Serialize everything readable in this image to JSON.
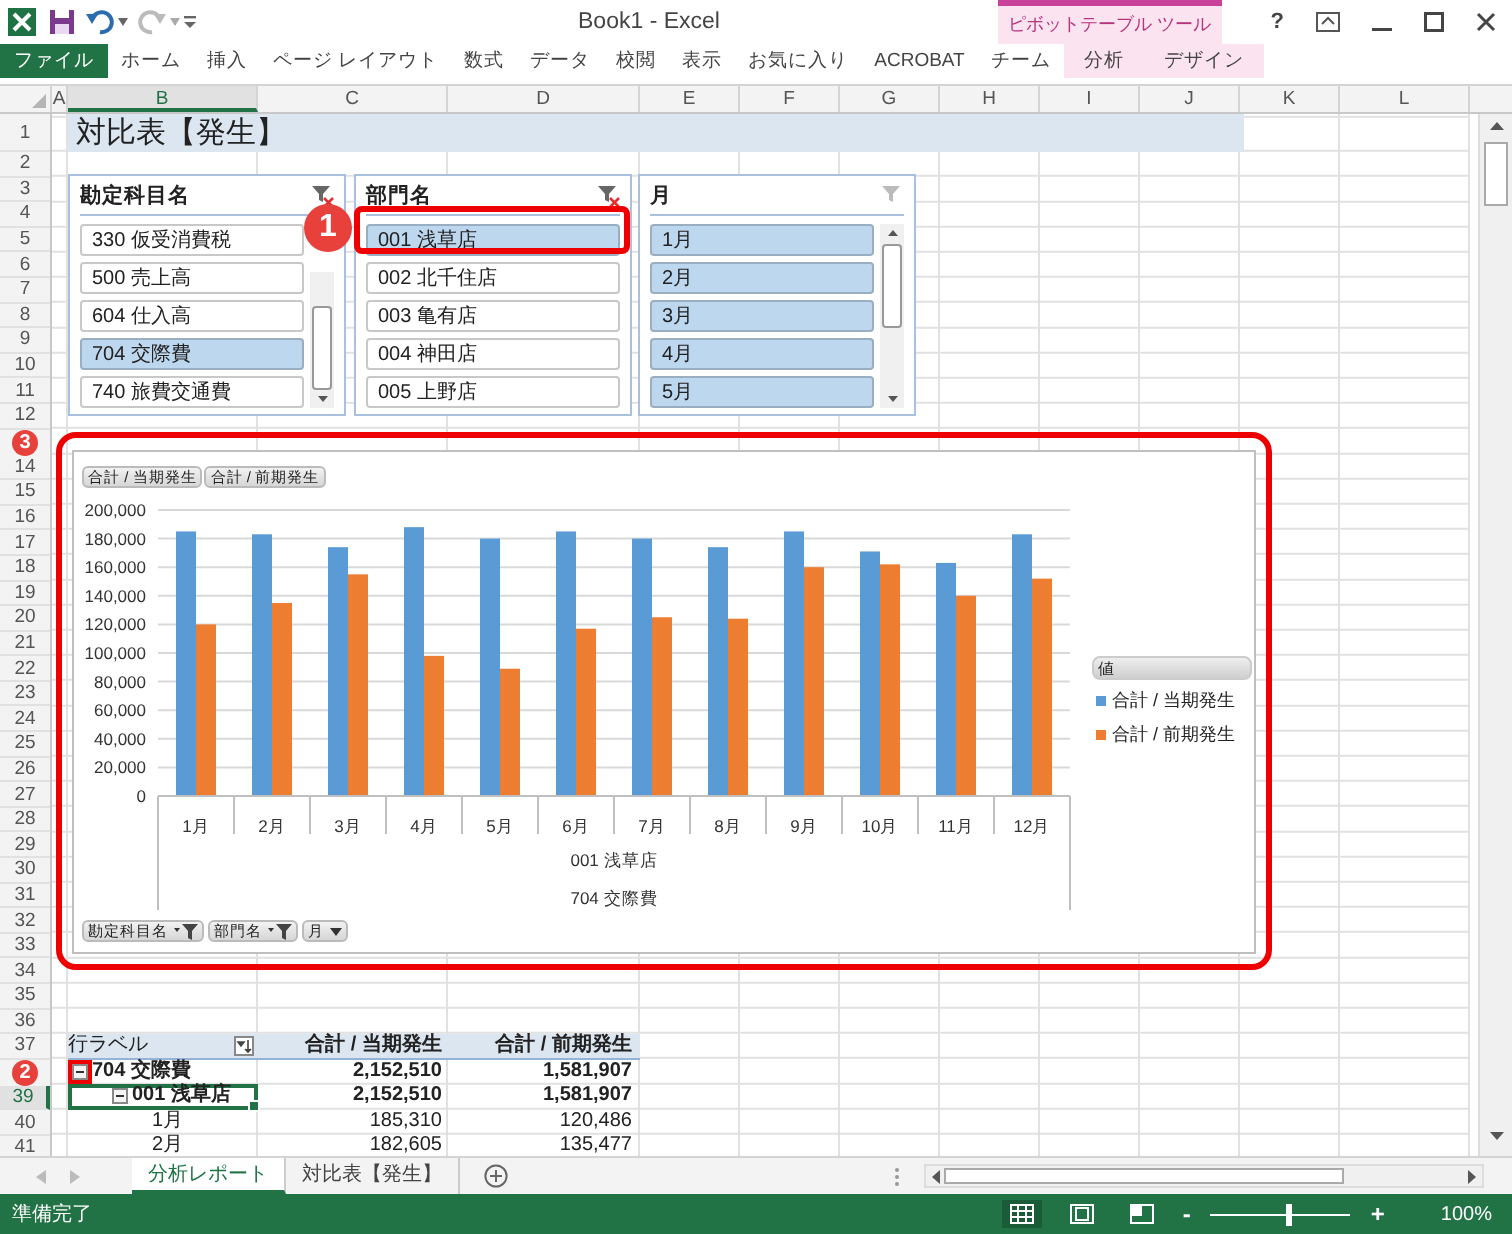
{
  "title_bar": {
    "title": "Book1 - Excel",
    "context_group": "ピボットテーブル ツール",
    "help": "?"
  },
  "ribbon_tabs": [
    {
      "label": "ファイル",
      "kind": "file"
    },
    {
      "label": "ホーム",
      "kind": "normal"
    },
    {
      "label": "挿入",
      "kind": "normal"
    },
    {
      "label": "ページ レイアウト",
      "kind": "normal"
    },
    {
      "label": "数式",
      "kind": "normal"
    },
    {
      "label": "データ",
      "kind": "normal"
    },
    {
      "label": "校閲",
      "kind": "normal"
    },
    {
      "label": "表示",
      "kind": "normal"
    },
    {
      "label": "お気に入り",
      "kind": "normal"
    },
    {
      "label": "ACROBAT",
      "kind": "normal"
    },
    {
      "label": "チーム",
      "kind": "normal"
    },
    {
      "label": "分析",
      "kind": "contextual"
    },
    {
      "label": "デザイン",
      "kind": "contextual"
    }
  ],
  "columns": [
    {
      "label": "A",
      "selected": false
    },
    {
      "label": "B",
      "selected": true
    },
    {
      "label": "C",
      "selected": false
    },
    {
      "label": "D",
      "selected": false
    },
    {
      "label": "E",
      "selected": false
    },
    {
      "label": "F",
      "selected": false
    },
    {
      "label": "G",
      "selected": false
    },
    {
      "label": "H",
      "selected": false
    },
    {
      "label": "I",
      "selected": false
    },
    {
      "label": "J",
      "selected": false
    },
    {
      "label": "K",
      "selected": false
    },
    {
      "label": "L",
      "selected": false
    }
  ],
  "rows": [
    {
      "label": "1",
      "selected": false
    },
    {
      "label": "2",
      "selected": false
    },
    {
      "label": "3",
      "selected": false
    },
    {
      "label": "4",
      "selected": false
    },
    {
      "label": "5",
      "selected": false
    },
    {
      "label": "6",
      "selected": false
    },
    {
      "label": "7",
      "selected": false
    },
    {
      "label": "8",
      "selected": false
    },
    {
      "label": "9",
      "selected": false
    },
    {
      "label": "10",
      "selected": false
    },
    {
      "label": "11",
      "selected": false
    },
    {
      "label": "12",
      "selected": false
    },
    {
      "label": "14",
      "selected": false
    },
    {
      "label": "15",
      "selected": false
    },
    {
      "label": "16",
      "selected": false
    },
    {
      "label": "17",
      "selected": false
    },
    {
      "label": "18",
      "selected": false
    },
    {
      "label": "19",
      "selected": false
    },
    {
      "label": "20",
      "selected": false
    },
    {
      "label": "21",
      "selected": false
    },
    {
      "label": "22",
      "selected": false
    },
    {
      "label": "23",
      "selected": false
    },
    {
      "label": "24",
      "selected": false
    },
    {
      "label": "25",
      "selected": false
    },
    {
      "label": "26",
      "selected": false
    },
    {
      "label": "27",
      "selected": false
    },
    {
      "label": "28",
      "selected": false
    },
    {
      "label": "29",
      "selected": false
    },
    {
      "label": "30",
      "selected": false
    },
    {
      "label": "31",
      "selected": false
    },
    {
      "label": "32",
      "selected": false
    },
    {
      "label": "33",
      "selected": false
    },
    {
      "label": "34",
      "selected": false
    },
    {
      "label": "35",
      "selected": false
    },
    {
      "label": "36",
      "selected": false
    },
    {
      "label": "37",
      "selected": false
    },
    {
      "label": "39",
      "selected": true
    },
    {
      "label": "40",
      "selected": false
    },
    {
      "label": "41",
      "selected": false
    }
  ],
  "sheet_title": "対比表【発生】",
  "slicers": [
    {
      "title": "勘定科目名",
      "filtered": true,
      "items": [
        {
          "label": "330 仮受消費税",
          "selected": false
        },
        {
          "label": "500 売上高",
          "selected": false
        },
        {
          "label": "604 仕入高",
          "selected": false
        },
        {
          "label": "704 交際費",
          "selected": true
        },
        {
          "label": "740 旅費交通費",
          "selected": false
        }
      ]
    },
    {
      "title": "部門名",
      "filtered": true,
      "items": [
        {
          "label": "001 浅草店",
          "selected": true
        },
        {
          "label": "002 北千住店",
          "selected": false
        },
        {
          "label": "003 亀有店",
          "selected": false
        },
        {
          "label": "004 神田店",
          "selected": false
        },
        {
          "label": "005 上野店",
          "selected": false
        }
      ]
    },
    {
      "title": "月",
      "filtered": false,
      "items": [
        {
          "label": "1月",
          "selected": true
        },
        {
          "label": "2月",
          "selected": true
        },
        {
          "label": "3月",
          "selected": true
        },
        {
          "label": "4月",
          "selected": true
        },
        {
          "label": "5月",
          "selected": true
        }
      ]
    }
  ],
  "chart": {
    "value_buttons": [
      "合計 / 当期発生",
      "合計 / 前期発生"
    ],
    "legend_title": "値",
    "axis_groups": [
      "001 浅草店",
      "704 交際費"
    ],
    "field_buttons": [
      {
        "label": "勘定科目名",
        "filtered": true
      },
      {
        "label": "部門名",
        "filtered": true
      },
      {
        "label": "月",
        "filtered": false
      }
    ],
    "chart_data": {
      "type": "bar",
      "categories": [
        "1月",
        "2月",
        "3月",
        "4月",
        "5月",
        "6月",
        "7月",
        "8月",
        "9月",
        "10月",
        "11月",
        "12月"
      ],
      "series": [
        {
          "name": "合計 / 当期発生",
          "color": "#5b9bd5",
          "values": [
            185000,
            183000,
            174000,
            188000,
            180000,
            185000,
            180000,
            174000,
            185000,
            171000,
            163000,
            183000
          ]
        },
        {
          "name": "合計 / 前期発生",
          "color": "#ed7d31",
          "values": [
            120000,
            135000,
            155000,
            98000,
            89000,
            117000,
            125000,
            124000,
            160000,
            162000,
            140000,
            152000
          ]
        }
      ],
      "grid": true,
      "legend": true,
      "ylim": [
        0,
        200000
      ],
      "yticks": [
        {
          "value": 0,
          "label": "0"
        },
        {
          "value": 20000,
          "label": "20,000"
        },
        {
          "value": 40000,
          "label": "40,000"
        },
        {
          "value": 60000,
          "label": "60,000"
        },
        {
          "value": 80000,
          "label": "80,000"
        },
        {
          "value": 100000,
          "label": "100,000"
        },
        {
          "value": 120000,
          "label": "120,000"
        },
        {
          "value": 140000,
          "label": "140,000"
        },
        {
          "value": 160000,
          "label": "160,000"
        },
        {
          "value": 180000,
          "label": "180,000"
        },
        {
          "value": 200000,
          "label": "200,000"
        }
      ]
    }
  },
  "pivot": {
    "row_label": "行ラベル",
    "columns": [
      "合計 / 当期発生",
      "合計 / 前期発生"
    ],
    "rows": [
      {
        "label": "704 交際費",
        "values": [
          "2,152,510",
          "1,581,907"
        ],
        "expanded": true,
        "selected": false,
        "children": [
          {
            "label": "001 浅草店",
            "values": [
              "2,152,510",
              "1,581,907"
            ],
            "expanded": true,
            "selected": true,
            "children": [
              {
                "label": "1月",
                "values": [
                  "185,310",
                  "120,486"
                ],
                "selected": false
              },
              {
                "label": "2月",
                "values": [
                  "182,605",
                  "135,477"
                ],
                "selected": false
              }
            ]
          }
        ]
      }
    ]
  },
  "callouts": [
    "1",
    "2",
    "3"
  ],
  "sheet_tabs": [
    {
      "label": "分析レポート",
      "selected": true
    },
    {
      "label": "対比表【発生】",
      "selected": false
    }
  ],
  "status_bar": {
    "status": "準備完了",
    "zoom_out": "-",
    "zoom_in": "+",
    "zoom": "100%",
    "zoom_slider": {
      "level": 0.55
    }
  }
}
